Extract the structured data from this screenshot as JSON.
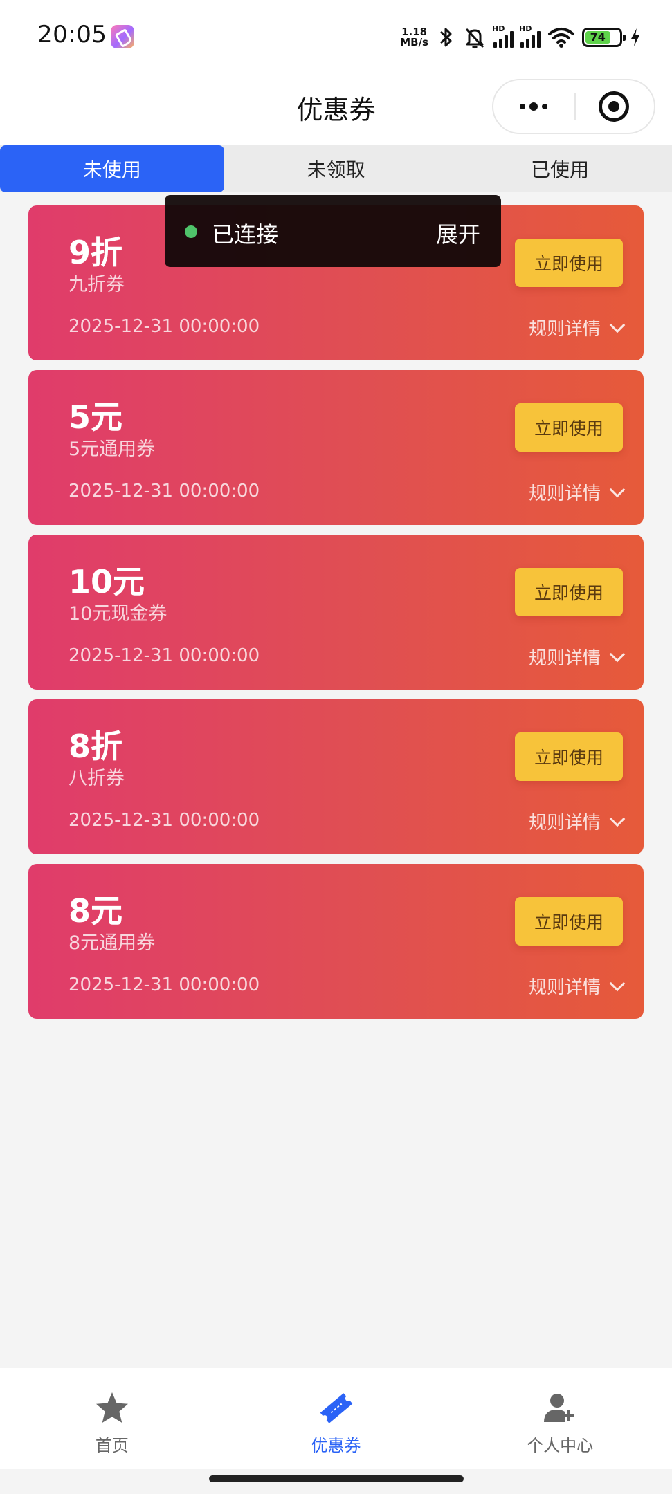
{
  "status_bar": {
    "time": "20:05",
    "net_speed_value": "1.18",
    "net_speed_unit": "MB/s",
    "signal_label_1": "HD",
    "signal_label_2": "HD",
    "battery": "74",
    "icons": [
      "app-icon",
      "bluetooth-icon",
      "mute-bell-icon",
      "signal-icon",
      "signal-icon",
      "wifi-icon",
      "battery-icon",
      "charging-icon"
    ]
  },
  "nav": {
    "title": "优惠券"
  },
  "tabs": [
    {
      "label": "未使用",
      "active": true
    },
    {
      "label": "未领取",
      "active": false
    },
    {
      "label": "已使用",
      "active": false
    }
  ],
  "toast": {
    "status": "已连接",
    "action": "展开"
  },
  "coupons": [
    {
      "title": "9折",
      "subtitle": "九折券",
      "date": "2025-12-31 00:00:00",
      "button": "立即使用",
      "rule": "规则详情"
    },
    {
      "title": "5元",
      "subtitle": "5元通用券",
      "date": "2025-12-31 00:00:00",
      "button": "立即使用",
      "rule": "规则详情"
    },
    {
      "title": "10元",
      "subtitle": "10元现金券",
      "date": "2025-12-31 00:00:00",
      "button": "立即使用",
      "rule": "规则详情"
    },
    {
      "title": "8折",
      "subtitle": "八折券",
      "date": "2025-12-31 00:00:00",
      "button": "立即使用",
      "rule": "规则详情"
    },
    {
      "title": "8元",
      "subtitle": "8元通用券",
      "date": "2025-12-31 00:00:00",
      "button": "立即使用",
      "rule": "规则详情"
    }
  ],
  "tabbar": [
    {
      "label": "首页",
      "icon": "star-icon",
      "active": false
    },
    {
      "label": "优惠券",
      "icon": "ticket-icon",
      "active": true
    },
    {
      "label": "个人中心",
      "icon": "person-add-icon",
      "active": false
    }
  ],
  "colors": {
    "accent": "#2b63f6",
    "coupon_gradient_start": "#e03c6b",
    "coupon_gradient_end": "#e65a3a",
    "use_button": "#f7c33a",
    "connected_dot": "#4fc36a"
  }
}
